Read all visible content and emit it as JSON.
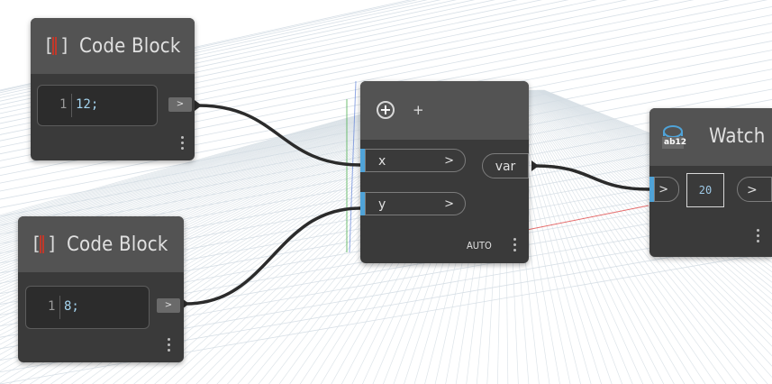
{
  "nodes": {
    "code_block_1": {
      "title": "Code Block",
      "line_number": "1",
      "code": "12;",
      "output_chip": ">"
    },
    "code_block_2": {
      "title": "Code Block",
      "line_number": "1",
      "code": "8;",
      "output_chip": ">"
    },
    "add_node": {
      "title": "+",
      "inputs": [
        {
          "label": "x",
          "chevron": ">"
        },
        {
          "label": "y",
          "chevron": ">"
        }
      ],
      "output": "var",
      "lacing": "AUTO"
    },
    "watch": {
      "title": "Watch",
      "icon_text": "ab12",
      "input_chevron": ">",
      "value": "20",
      "output_chevron": ">"
    }
  },
  "colors": {
    "node_body": "#3a3a3a",
    "node_header": "#535353",
    "port_accent": "#4fa3d8",
    "code_text": "#a5d4ef",
    "grid_line": "#d4dde4",
    "axis_red": "#e04a4a",
    "axis_green": "#4caf50",
    "axis_blue": "#4a6fd6"
  },
  "icons": [
    "code-block-icon",
    "plus-circle-icon",
    "watch-icon",
    "more-options-icon"
  ]
}
